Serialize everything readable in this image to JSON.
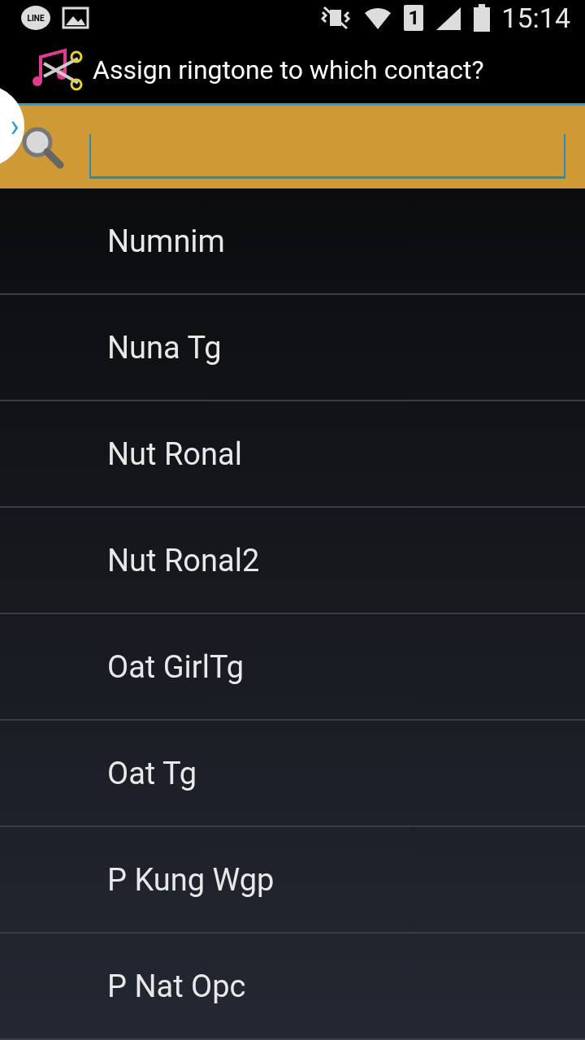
{
  "status_bar": {
    "notification_app": "LINE",
    "sim_slot": "1",
    "time": "15:14"
  },
  "title_bar": {
    "title": "Assign ringtone to which contact?"
  },
  "side_tab": {
    "glyph": "›"
  },
  "contacts": [
    {
      "name": "Numnim"
    },
    {
      "name": "Nuna Tg"
    },
    {
      "name": "Nut Ronal"
    },
    {
      "name": "Nut Ronal2"
    },
    {
      "name": "Oat GirlTg"
    },
    {
      "name": "Oat Tg"
    },
    {
      "name": "P Kung Wgp"
    },
    {
      "name": "P Nat Opc"
    }
  ]
}
